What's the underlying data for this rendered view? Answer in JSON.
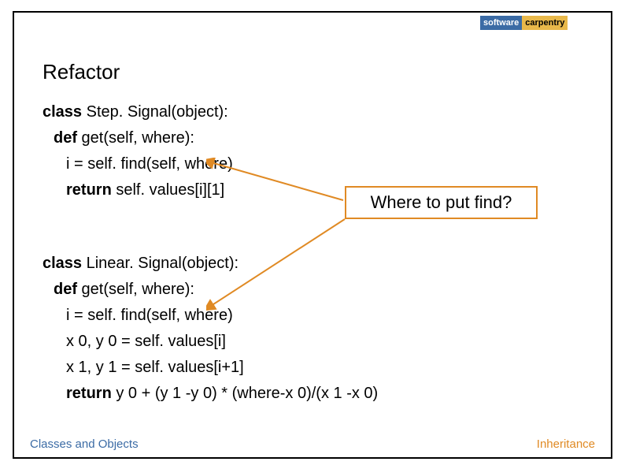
{
  "logo": {
    "left": "software",
    "right": "carpentry",
    "sub": ""
  },
  "title": "Refactor",
  "code1": {
    "line1_a": "class",
    "line1_b": " Step. Signal(object):",
    "line2_a": "def",
    "line2_b": " get(self, where):",
    "line3": "i = self. find(self, where)",
    "line4_a": "return",
    "line4_b": " self. values[i][1]"
  },
  "callout": "Where to put find?",
  "code2": {
    "line1_a": "class",
    "line1_b": " Linear. Signal(object):",
    "line2_a": "def",
    "line2_b": " get(self, where):",
    "line3": "i = self. find(self, where)",
    "line4": "x 0, y 0 = self. values[i]",
    "line5": "x 1, y 1 = self. values[i+1]",
    "line6_a": "return",
    "line6_b": " y 0 + (y 1 -y 0) * (where-x 0)/(x 1 -x 0)"
  },
  "footer": {
    "left": "Classes and Objects",
    "right": "Inheritance"
  }
}
